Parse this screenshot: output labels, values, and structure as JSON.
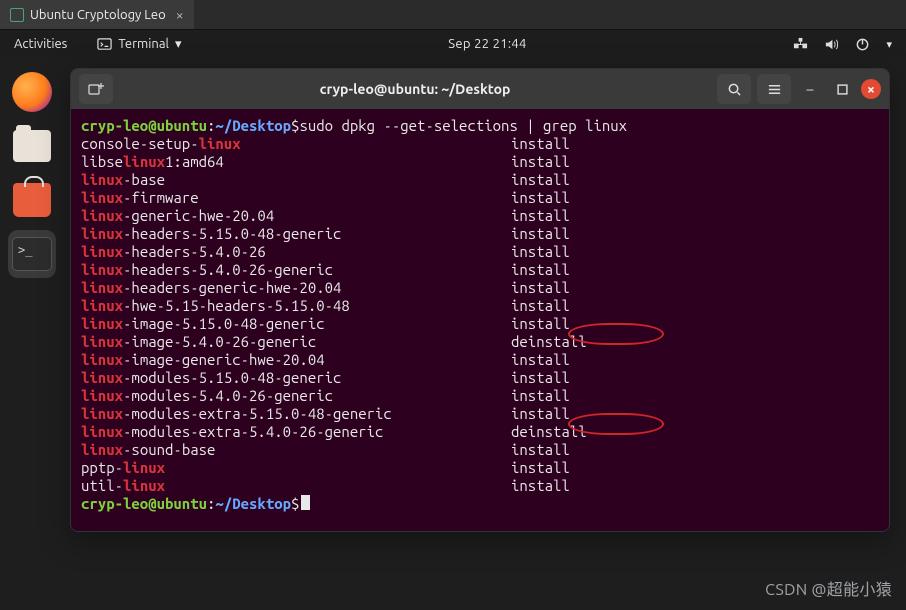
{
  "vmtab": {
    "title": "Ubuntu Cryptology Leo"
  },
  "topbar": {
    "activities": "Activities",
    "app": "Terminal",
    "clock": "Sep 22  21:44"
  },
  "terminal": {
    "title": "cryp-leo@ubuntu: ~/Desktop",
    "prompt": {
      "user": "cryp-leo",
      "host": "ubuntu",
      "path": "~/Desktop",
      "symbol": "$"
    },
    "command": "sudo dpkg --get-selections | grep linux",
    "output": [
      {
        "pkg_pre": "console-setup-",
        "pkg_hl": "linux",
        "pkg_post": "",
        "status": "install"
      },
      {
        "pkg_pre": "libse",
        "pkg_hl": "linux",
        "pkg_post": "1:amd64",
        "status": "install"
      },
      {
        "pkg_pre": "",
        "pkg_hl": "linux",
        "pkg_post": "-base",
        "status": "install"
      },
      {
        "pkg_pre": "",
        "pkg_hl": "linux",
        "pkg_post": "-firmware",
        "status": "install"
      },
      {
        "pkg_pre": "",
        "pkg_hl": "linux",
        "pkg_post": "-generic-hwe-20.04",
        "status": "install"
      },
      {
        "pkg_pre": "",
        "pkg_hl": "linux",
        "pkg_post": "-headers-5.15.0-48-generic",
        "status": "install"
      },
      {
        "pkg_pre": "",
        "pkg_hl": "linux",
        "pkg_post": "-headers-5.4.0-26",
        "status": "install"
      },
      {
        "pkg_pre": "",
        "pkg_hl": "linux",
        "pkg_post": "-headers-5.4.0-26-generic",
        "status": "install"
      },
      {
        "pkg_pre": "",
        "pkg_hl": "linux",
        "pkg_post": "-headers-generic-hwe-20.04",
        "status": "install"
      },
      {
        "pkg_pre": "",
        "pkg_hl": "linux",
        "pkg_post": "-hwe-5.15-headers-5.15.0-48",
        "status": "install"
      },
      {
        "pkg_pre": "",
        "pkg_hl": "linux",
        "pkg_post": "-image-5.15.0-48-generic",
        "status": "install"
      },
      {
        "pkg_pre": "",
        "pkg_hl": "linux",
        "pkg_post": "-image-5.4.0-26-generic",
        "status": "deinstall"
      },
      {
        "pkg_pre": "",
        "pkg_hl": "linux",
        "pkg_post": "-image-generic-hwe-20.04",
        "status": "install"
      },
      {
        "pkg_pre": "",
        "pkg_hl": "linux",
        "pkg_post": "-modules-5.15.0-48-generic",
        "status": "install"
      },
      {
        "pkg_pre": "",
        "pkg_hl": "linux",
        "pkg_post": "-modules-5.4.0-26-generic",
        "status": "install"
      },
      {
        "pkg_pre": "",
        "pkg_hl": "linux",
        "pkg_post": "-modules-extra-5.15.0-48-generic",
        "status": "install"
      },
      {
        "pkg_pre": "",
        "pkg_hl": "linux",
        "pkg_post": "-modules-extra-5.4.0-26-generic",
        "status": "deinstall"
      },
      {
        "pkg_pre": "",
        "pkg_hl": "linux",
        "pkg_post": "-sound-base",
        "status": "install"
      },
      {
        "pkg_pre": "pptp-",
        "pkg_hl": "linux",
        "pkg_post": "",
        "status": "install"
      },
      {
        "pkg_pre": "util-",
        "pkg_hl": "linux",
        "pkg_post": "",
        "status": "install"
      }
    ]
  },
  "watermark": "CSDN @超能小猿"
}
